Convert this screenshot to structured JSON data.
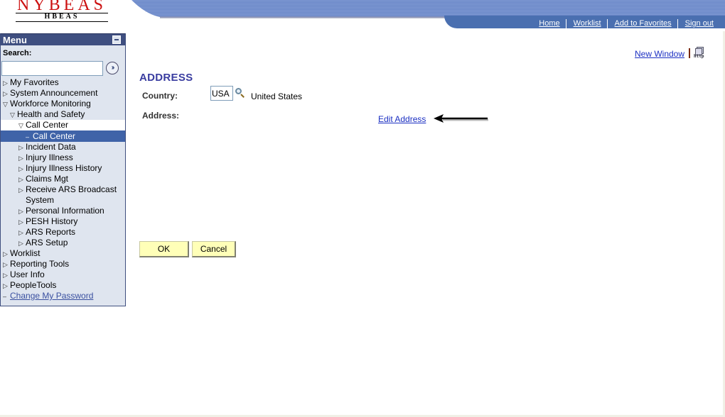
{
  "header": {
    "logo_brand": "NYBEAS",
    "logo_sub": "HBEAS",
    "nav_links": [
      "Home",
      "Worklist",
      "Add to Favorites",
      "Sign out"
    ]
  },
  "menu": {
    "title": "Menu",
    "search_label": "Search:",
    "search_value": "",
    "go_icon": "double-chevron-right-icon",
    "items": [
      {
        "label": "My Favorites",
        "level": 0,
        "state": "collapsed"
      },
      {
        "label": "System Announcement",
        "level": 0,
        "state": "collapsed"
      },
      {
        "label": "Workforce Monitoring",
        "level": 0,
        "state": "expanded"
      },
      {
        "label": "Health and Safety",
        "level": 1,
        "state": "expanded"
      },
      {
        "label": "Call Center",
        "level": 2,
        "state": "expanded"
      },
      {
        "label": "Call Center",
        "level": 3,
        "state": "selected"
      },
      {
        "label": "Incident Data",
        "level": 2,
        "state": "collapsed"
      },
      {
        "label": "Injury Illness",
        "level": 2,
        "state": "collapsed"
      },
      {
        "label": "Injury Illness History",
        "level": 2,
        "state": "collapsed"
      },
      {
        "label": "Claims Mgt",
        "level": 2,
        "state": "collapsed"
      },
      {
        "label": "Receive ARS Broadcast System",
        "level": 2,
        "state": "collapsed"
      },
      {
        "label": "Personal Information",
        "level": 2,
        "state": "collapsed"
      },
      {
        "label": "PESH History",
        "level": 2,
        "state": "collapsed"
      },
      {
        "label": "ARS Reports",
        "level": 2,
        "state": "collapsed"
      },
      {
        "label": "ARS Setup",
        "level": 2,
        "state": "collapsed"
      },
      {
        "label": "Worklist",
        "level": 0,
        "state": "collapsed"
      },
      {
        "label": "Reporting Tools",
        "level": 0,
        "state": "collapsed"
      },
      {
        "label": "User Info",
        "level": 0,
        "state": "collapsed"
      },
      {
        "label": "PeopleTools",
        "level": 0,
        "state": "collapsed"
      },
      {
        "label": "Change My Password",
        "level": 0,
        "state": "link"
      }
    ]
  },
  "content": {
    "new_window_label": "New Window",
    "http_icon_text": "http",
    "title": "ADDRESS",
    "country_label": "Country:",
    "country_value": "USA",
    "country_description": "United States",
    "address_label": "Address:",
    "edit_address_label": "Edit Address",
    "ok_label": "OK",
    "cancel_label": "Cancel"
  },
  "colors": {
    "menu_header": "#3f4f80",
    "menu_bg": "#dfe5ef",
    "selected_item": "#3f63a8",
    "title": "#3a3da0",
    "link": "#1b2fc2",
    "button_bg": "#ffffb8",
    "nav_bar": "#4a6fb0"
  }
}
